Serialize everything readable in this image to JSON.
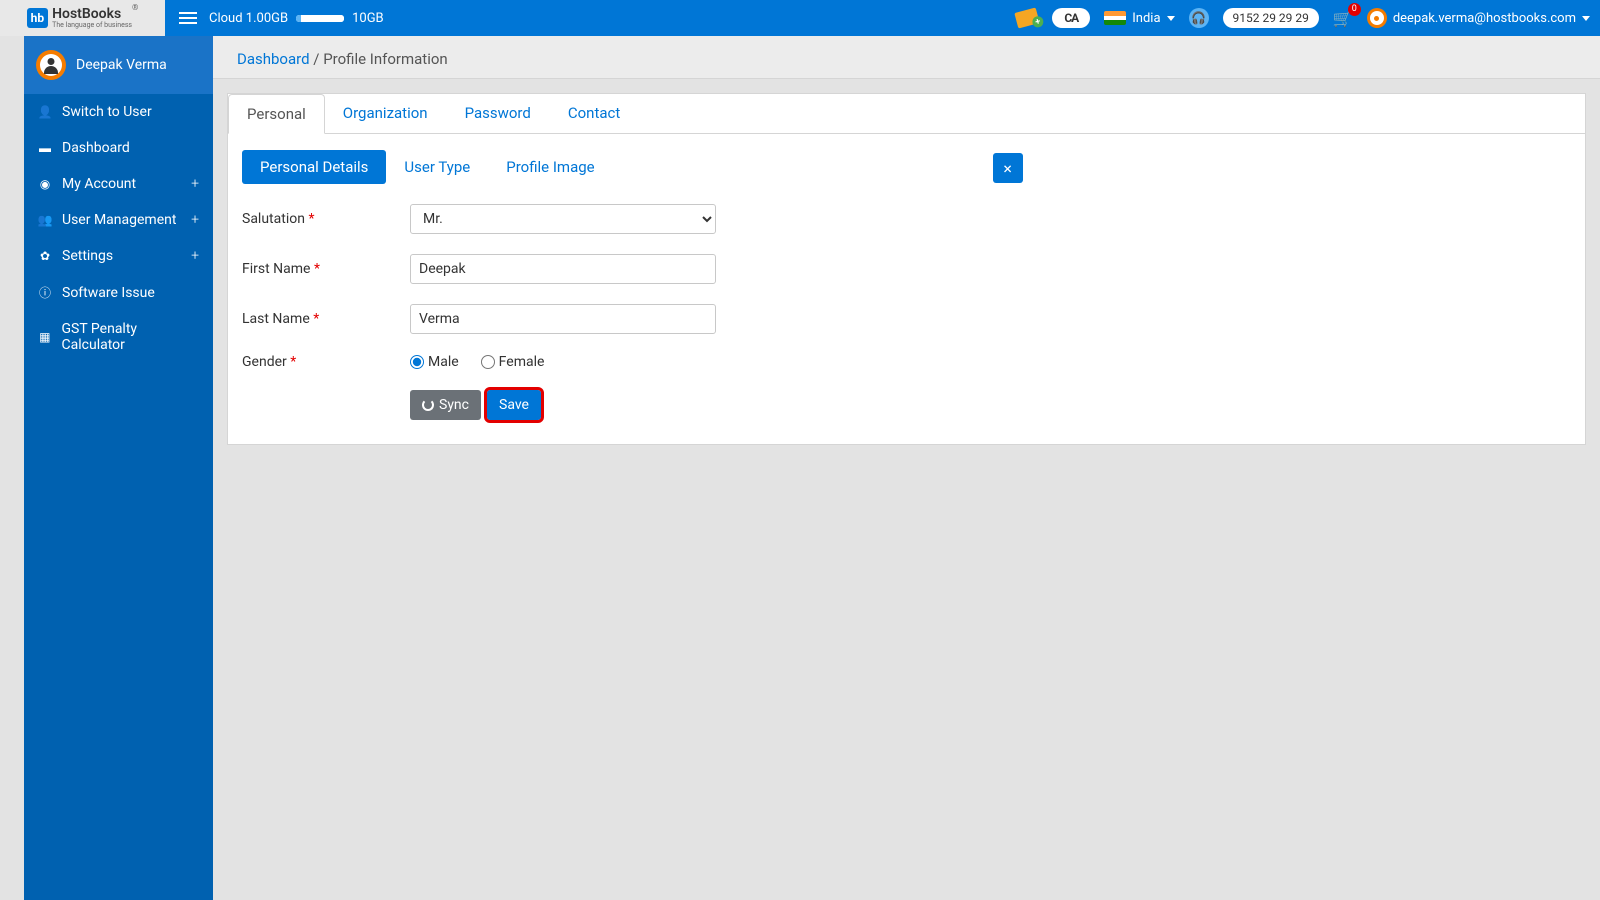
{
  "topbar": {
    "logo_main": "HostBooks",
    "logo_sub": "The language of business",
    "cloud_label": "Cloud",
    "cloud_used": "1.00GB",
    "cloud_total": "10GB",
    "country": "India",
    "phone": "9152 29 29 29",
    "cart_count": "0",
    "user_email": "deepak.verma@hostbooks.com",
    "ca_label": "CA"
  },
  "sidebar": {
    "user_name": "Deepak Verma",
    "items": [
      {
        "icon": "user",
        "label": "Switch to User",
        "expandable": false
      },
      {
        "icon": "dash",
        "label": "Dashboard",
        "expandable": false
      },
      {
        "icon": "account",
        "label": "My Account",
        "expandable": true
      },
      {
        "icon": "users",
        "label": "User Management",
        "expandable": true
      },
      {
        "icon": "gear",
        "label": "Settings",
        "expandable": true
      },
      {
        "icon": "info",
        "label": "Software Issue",
        "expandable": false
      },
      {
        "icon": "calc",
        "label": "GST Penalty Calculator",
        "expandable": false
      }
    ]
  },
  "breadcrumb": {
    "link": "Dashboard",
    "sep": " / ",
    "current": "Profile Information"
  },
  "tabs1": [
    {
      "label": "Personal",
      "active": true
    },
    {
      "label": "Organization",
      "active": false
    },
    {
      "label": "Password",
      "active": false
    },
    {
      "label": "Contact",
      "active": false
    }
  ],
  "tabs2": [
    {
      "label": "Personal Details",
      "active": true
    },
    {
      "label": "User Type",
      "active": false
    },
    {
      "label": "Profile Image",
      "active": false
    }
  ],
  "form": {
    "salutation_label": "Salutation",
    "salutation_value": "Mr.",
    "first_name_label": "First Name",
    "first_name_value": "Deepak",
    "last_name_label": "Last Name",
    "last_name_value": "Verma",
    "gender_label": "Gender",
    "gender_male": "Male",
    "gender_female": "Female",
    "sync_label": "Sync",
    "save_label": "Save",
    "close_label": "×"
  }
}
